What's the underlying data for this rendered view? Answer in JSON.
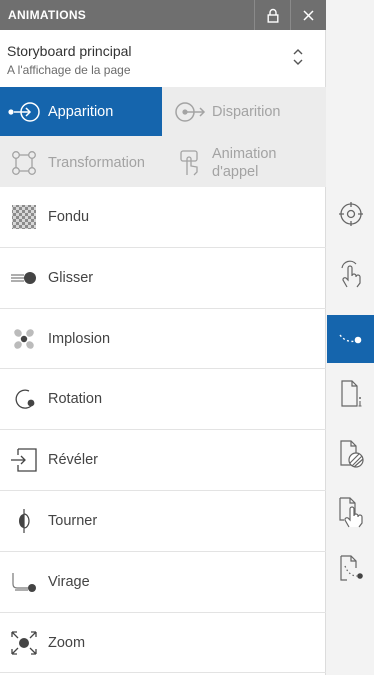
{
  "header": {
    "title": "ANIMATIONS",
    "lock_icon": "lock-icon",
    "close_icon": "close-icon"
  },
  "storyboard": {
    "name": "Storyboard principal",
    "trigger": "A l'affichage de la page",
    "selector_icon": "updown-chevron-icon"
  },
  "tabs": [
    {
      "label": "Apparition",
      "icon": "appear-icon",
      "active": true
    },
    {
      "label": "Disparition",
      "icon": "disappear-icon",
      "active": false
    },
    {
      "label": "Transformation",
      "icon": "transform-icon",
      "active": false
    },
    {
      "label_line1": "Animation",
      "label_line2": "d'appel",
      "icon": "tap-icon",
      "active": false
    }
  ],
  "animations": [
    {
      "label": "Fondu",
      "icon": "fade-icon"
    },
    {
      "label": "Glisser",
      "icon": "slide-icon"
    },
    {
      "label": "Implosion",
      "icon": "implode-icon"
    },
    {
      "label": "Rotation",
      "icon": "rotation-icon"
    },
    {
      "label": "Révéler",
      "icon": "reveal-icon"
    },
    {
      "label": "Tourner",
      "icon": "flip-icon"
    },
    {
      "label": "Virage",
      "icon": "curve-icon"
    },
    {
      "label": "Zoom",
      "icon": "zoom-icon"
    }
  ],
  "rail": [
    {
      "icon": "target-icon",
      "active": false
    },
    {
      "icon": "hand-pointer-icon",
      "active": false
    },
    {
      "icon": "motion-path-icon",
      "active": true
    },
    {
      "icon": "page-info-icon",
      "active": false
    },
    {
      "icon": "page-pattern-icon",
      "active": false
    },
    {
      "icon": "page-hand-icon",
      "active": false
    },
    {
      "icon": "page-path-icon",
      "active": false
    }
  ],
  "colors": {
    "accent": "#1565ad",
    "header": "#6f6f6f",
    "tab_bg": "#ececec",
    "text": "#444444",
    "muted_text": "#a3a3a3"
  }
}
